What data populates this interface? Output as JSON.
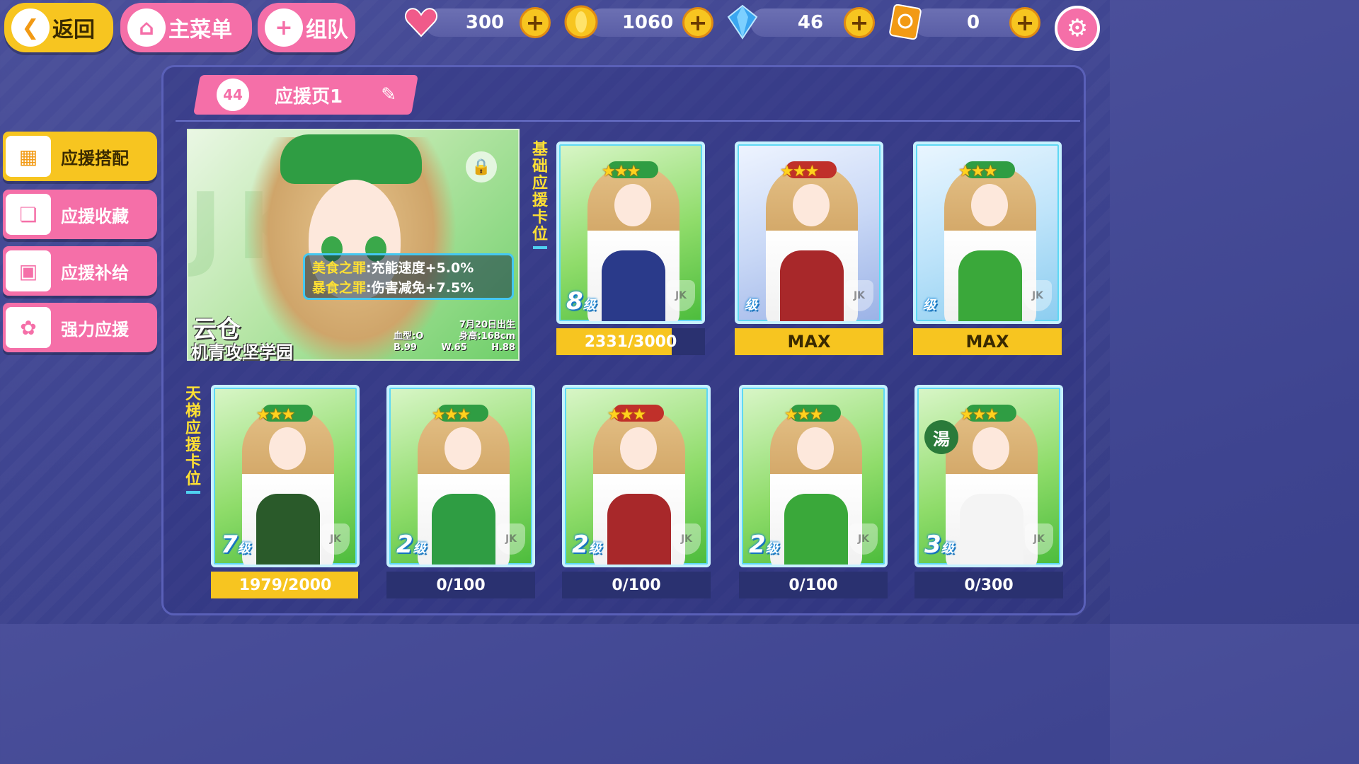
{
  "top": {
    "back_label": "返回",
    "menu_label": "主菜单",
    "team_label": "组队",
    "back_icon": "back-arrow-icon",
    "home_icon": "home-icon",
    "plus_icon": "plus-icon"
  },
  "resources": [
    {
      "name": "stamina",
      "icon": "heart-icon",
      "value": "300",
      "color": "#f05a8a"
    },
    {
      "name": "coins",
      "icon": "coin-icon",
      "value": "1060",
      "color": "#f7c520"
    },
    {
      "name": "gems",
      "icon": "diamond-icon",
      "value": "46",
      "color": "#3aa6f0"
    },
    {
      "name": "tickets",
      "icon": "ticket-icon",
      "value": "0",
      "color": "#f29a14"
    }
  ],
  "settings_icon": "gear-icon",
  "page_tab": {
    "number": "44",
    "title": "应援页1",
    "edit_icon": "pencil-icon"
  },
  "sidebar": {
    "items": [
      {
        "label": "应援搭配",
        "icon": "deck-icon",
        "active": true
      },
      {
        "label": "应援收藏",
        "icon": "collection-icon",
        "active": false
      },
      {
        "label": "应援补给",
        "icon": "supply-chest-icon",
        "active": false
      },
      {
        "label": "强力应援",
        "icon": "power-support-icon",
        "active": false
      }
    ]
  },
  "feature": {
    "bg_text": "JK",
    "lock_icon": "lock-icon",
    "buffs": [
      {
        "name": "美食之罪",
        "effect": ":充能速度+5.0%"
      },
      {
        "name": "暴食之罪",
        "effect": ":伤害减免+7.5%"
      }
    ],
    "char_name": "云仓",
    "school": "机青攻坚学园",
    "birthday": "7月20日出生",
    "blood": "血型:O",
    "height": "身高:168cm",
    "b": "B.99",
    "w": "W.65",
    "h": "H.88"
  },
  "sections": {
    "basic": "基础应援卡位",
    "ladder": "天梯应援卡位"
  },
  "basic_cards": [
    {
      "level": "8",
      "suffix": "级",
      "exp": "2331/3000",
      "progress": 0.777,
      "theme": "green",
      "dress": "#2a3a8a",
      "bow": "#2f9d43"
    },
    {
      "level": "",
      "suffix": "级",
      "exp": "MAX",
      "progress": 1,
      "theme": "red",
      "dress": "#a8282a",
      "bow": "#c0302a"
    },
    {
      "level": "",
      "suffix": "级",
      "exp": "MAX",
      "progress": 1,
      "theme": "blue",
      "dress": "#3aa83a",
      "bow": "#2f9d43"
    }
  ],
  "ladder_cards": [
    {
      "level": "7",
      "suffix": "级",
      "exp": "1979/2000",
      "progress": 0.9895,
      "theme": "green",
      "dress": "#2a5a2a",
      "bow": "#2f9d43",
      "badge": ""
    },
    {
      "level": "2",
      "suffix": "级",
      "exp": "0/100",
      "progress": 0,
      "theme": "green",
      "dress": "#2f9d43",
      "bow": "#2f9d43",
      "badge": ""
    },
    {
      "level": "2",
      "suffix": "级",
      "exp": "0/100",
      "progress": 0,
      "theme": "green",
      "dress": "#a8282a",
      "bow": "#c0302a",
      "badge": ""
    },
    {
      "level": "2",
      "suffix": "级",
      "exp": "0/100",
      "progress": 0,
      "theme": "green",
      "dress": "#3aa83a",
      "bow": "#2f9d43",
      "badge": ""
    },
    {
      "level": "3",
      "suffix": "级",
      "exp": "0/300",
      "progress": 0,
      "theme": "green",
      "dress": "#f4f4f4",
      "bow": "#2f9d43",
      "badge": "湯"
    }
  ],
  "card_logo": "JK",
  "stars": "★★★"
}
